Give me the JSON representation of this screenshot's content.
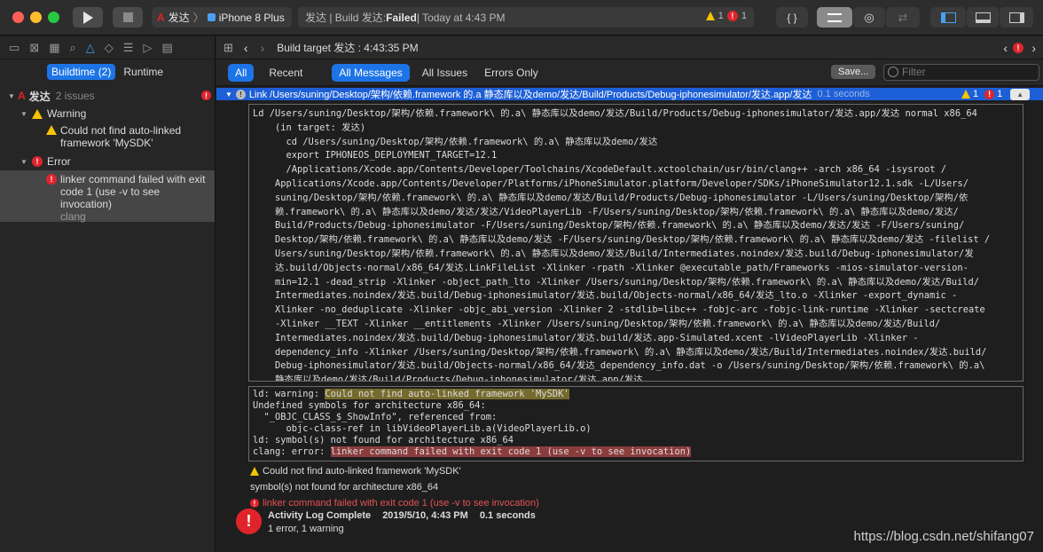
{
  "toolbar": {
    "scheme_name": "发达",
    "device_name": "iPhone 8 Plus",
    "status_prefix": "发达 | Build 发达: ",
    "status_bold": "Failed",
    "status_suffix": " | Today at 4:43 PM",
    "warning_count": "1",
    "error_count": "1",
    "colors": {
      "close": "#fe5f57",
      "minimize": "#febc2e",
      "zoom": "#28c840"
    }
  },
  "navigator": {
    "seg_buildtime": "Buildtime (2)",
    "seg_runtime": "Runtime",
    "project_name": "发达",
    "project_issues": "2 issues",
    "group_warning": "Warning",
    "warning_item": "Could not find auto-linked framework 'MySDK'",
    "group_error": "Error",
    "error_item": "linker command failed with exit code 1 (use -v to see invocation)",
    "error_item_sub": "clang"
  },
  "jumpbar": {
    "title": "Build target 发达 : 4:43:35 PM"
  },
  "filters": {
    "all": "All",
    "recent": "Recent",
    "all_messages": "All Messages",
    "all_issues": "All Issues",
    "errors_only": "Errors Only",
    "save": "Save...",
    "filter_placeholder": "Filter"
  },
  "log": {
    "link_line": "Link /Users/suning/Desktop/架构/依赖.framework 的.a 静态库以及demo/发达/Build/Products/Debug-iphonesimulator/发达.app/发达",
    "link_secs": "0.1 seconds",
    "link_warn": "1",
    "link_err": "1",
    "command": "Ld /Users/suning/Desktop/架构/依赖.framework\\ 的.a\\ 静态库以及demo/发达/Build/Products/Debug-iphonesimulator/发达.app/发达 normal x86_64\n    (in target: 发达)\n      cd /Users/suning/Desktop/架构/依赖.framework\\ 的.a\\ 静态库以及demo/发达\n      export IPHONEOS_DEPLOYMENT_TARGET=12.1\n      /Applications/Xcode.app/Contents/Developer/Toolchains/XcodeDefault.xctoolchain/usr/bin/clang++ -arch x86_64 -isysroot /\n    Applications/Xcode.app/Contents/Developer/Platforms/iPhoneSimulator.platform/Developer/SDKs/iPhoneSimulator12.1.sdk -L/Users/\n    suning/Desktop/架构/依赖.framework\\ 的.a\\ 静态库以及demo/发达/Build/Products/Debug-iphonesimulator -L/Users/suning/Desktop/架构/依\n    赖.framework\\ 的.a\\ 静态库以及demo/发达/发达/VideoPlayerLib -F/Users/suning/Desktop/架构/依赖.framework\\ 的.a\\ 静态库以及demo/发达/\n    Build/Products/Debug-iphonesimulator -F/Users/suning/Desktop/架构/依赖.framework\\ 的.a\\ 静态库以及demo/发达/发达 -F/Users/suning/\n    Desktop/架构/依赖.framework\\ 的.a\\ 静态库以及demo/发达 -F/Users/suning/Desktop/架构/依赖.framework\\ 的.a\\ 静态库以及demo/发达 -filelist /\n    Users/suning/Desktop/架构/依赖.framework\\ 的.a\\ 静态库以及demo/发达/Build/Intermediates.noindex/发达.build/Debug-iphonesimulator/发\n    达.build/Objects-normal/x86_64/发达.LinkFileList -Xlinker -rpath -Xlinker @executable_path/Frameworks -mios-simulator-version-\n    min=12.1 -dead_strip -Xlinker -object_path_lto -Xlinker /Users/suning/Desktop/架构/依赖.framework\\ 的.a\\ 静态库以及demo/发达/Build/\n    Intermediates.noindex/发达.build/Debug-iphonesimulator/发达.build/Objects-normal/x86_64/发达_lto.o -Xlinker -export_dynamic -\n    Xlinker -no_deduplicate -Xlinker -objc_abi_version -Xlinker 2 -stdlib=libc++ -fobjc-arc -fobjc-link-runtime -Xlinker -sectcreate\n    -Xlinker __TEXT -Xlinker __entitlements -Xlinker /Users/suning/Desktop/架构/依赖.framework\\ 的.a\\ 静态库以及demo/发达/Build/\n    Intermediates.noindex/发达.build/Debug-iphonesimulator/发达.build/发达.app-Simulated.xcent -lVideoPlayerLib -Xlinker -\n    dependency_info -Xlinker /Users/suning/Desktop/架构/依赖.framework\\ 的.a\\ 静态库以及demo/发达/Build/Intermediates.noindex/发达.build/\n    Debug-iphonesimulator/发达.build/Objects-normal/x86_64/发达_dependency_info.dat -o /Users/suning/Desktop/架构/依赖.framework\\ 的.a\\\n    静态库以及demo/发达/Build/Products/Debug-iphonesimulator/发达.app/发达",
    "ld_warning_prefix": "ld: warning: ",
    "ld_warning_text": "Could not find auto-linked framework 'MySDK'",
    "undefined_lines": "Undefined symbols for architecture x86_64:\n  \"_OBJC_CLASS_$_ShowInfo\", referenced from:\n      objc-class-ref in libVideoPlayerLib.a(VideoPlayerLib.o)\nld: symbol(s) not found for architecture x86_64",
    "clang_prefix": "clang: error: ",
    "clang_text": "linker command failed with exit code 1 (use -v to see invocation)",
    "msg_warning": "Could not find auto-linked framework 'MySDK'",
    "msg_symbols": "symbol(s) not found for architecture x86_64",
    "msg_error": "linker command failed with exit code 1 (use -v to see invocation)",
    "summary_title": "Activity Log Complete",
    "summary_date": "2019/5/10, 4:43 PM",
    "summary_secs": "0.1 seconds",
    "summary_result": "1 error, 1 warning"
  },
  "watermark": "https://blog.csdn.net/shifang07"
}
